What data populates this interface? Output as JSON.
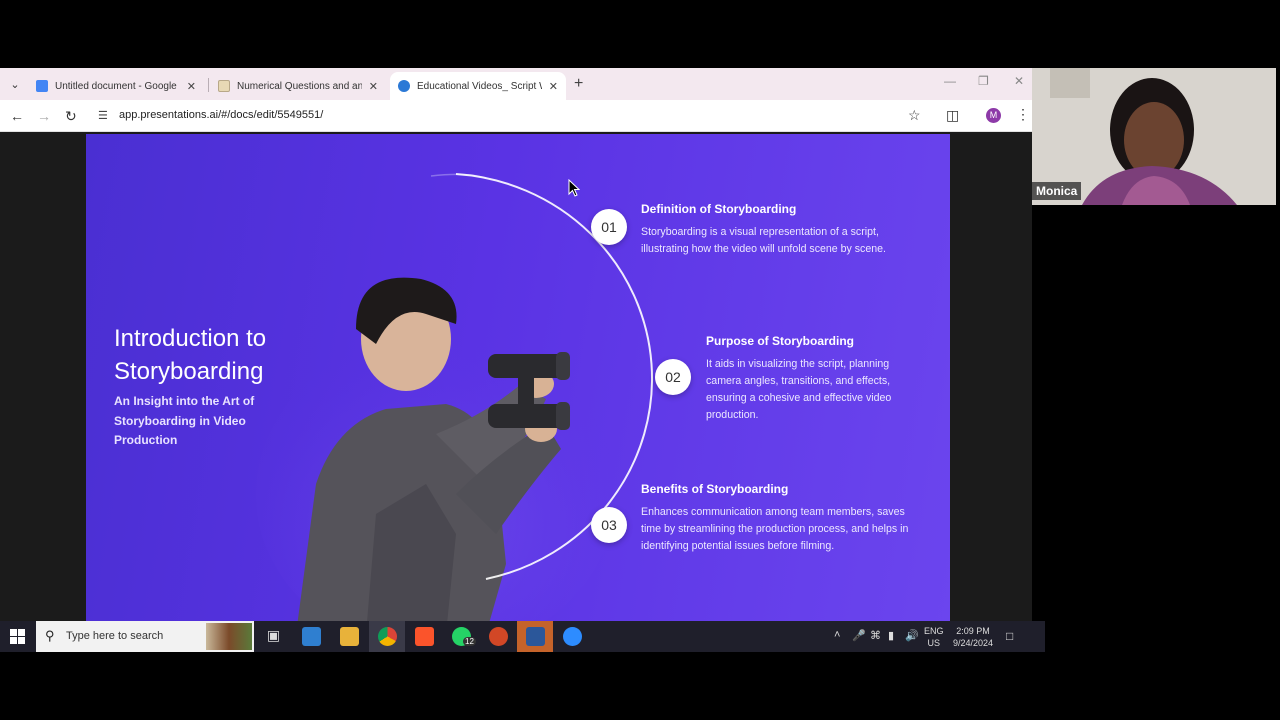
{
  "browser": {
    "tabs": [
      {
        "title": "Untitled document - Google Do",
        "icon": "google-docs-icon",
        "color": "#4285f4"
      },
      {
        "title": "Numerical Questions and answ",
        "icon": "document-icon",
        "color": "#e8d9b5"
      },
      {
        "title": "Educational Videos_ Script Writ",
        "icon": "presentations-ai-icon",
        "color": "#2b79d6"
      }
    ],
    "url": "app.presentations.ai/#/docs/edit/5549551/",
    "profile_initial": "M"
  },
  "slide": {
    "title": "Introduction to Storyboarding",
    "subtitle": "An Insight into the Art of Storyboarding in Video Production",
    "sections": [
      {
        "num": "01",
        "title": "Definition of Storyboarding",
        "body": "Storyboarding is a visual representation of a script, illustrating how the video will unfold scene by scene."
      },
      {
        "num": "02",
        "title": "Purpose of Storyboarding",
        "body": "It aids in visualizing the script, planning camera angles, transitions, and effects, ensuring a cohesive and effective video production."
      },
      {
        "num": "03",
        "title": "Benefits of Storyboarding",
        "body": "Enhances communication among team members, saves time by streamlining the production process, and helps in identifying potential issues before filming."
      }
    ],
    "colors": {
      "background": "#5a33e4",
      "text": "#ffffff"
    }
  },
  "taskbar": {
    "search_placeholder": "Type here to search",
    "lang_top": "ENG",
    "lang_bottom": "US",
    "time": "2:09 PM",
    "date": "9/24/2024",
    "whatsapp_badge": "12"
  },
  "webcam": {
    "name": "Monica"
  }
}
